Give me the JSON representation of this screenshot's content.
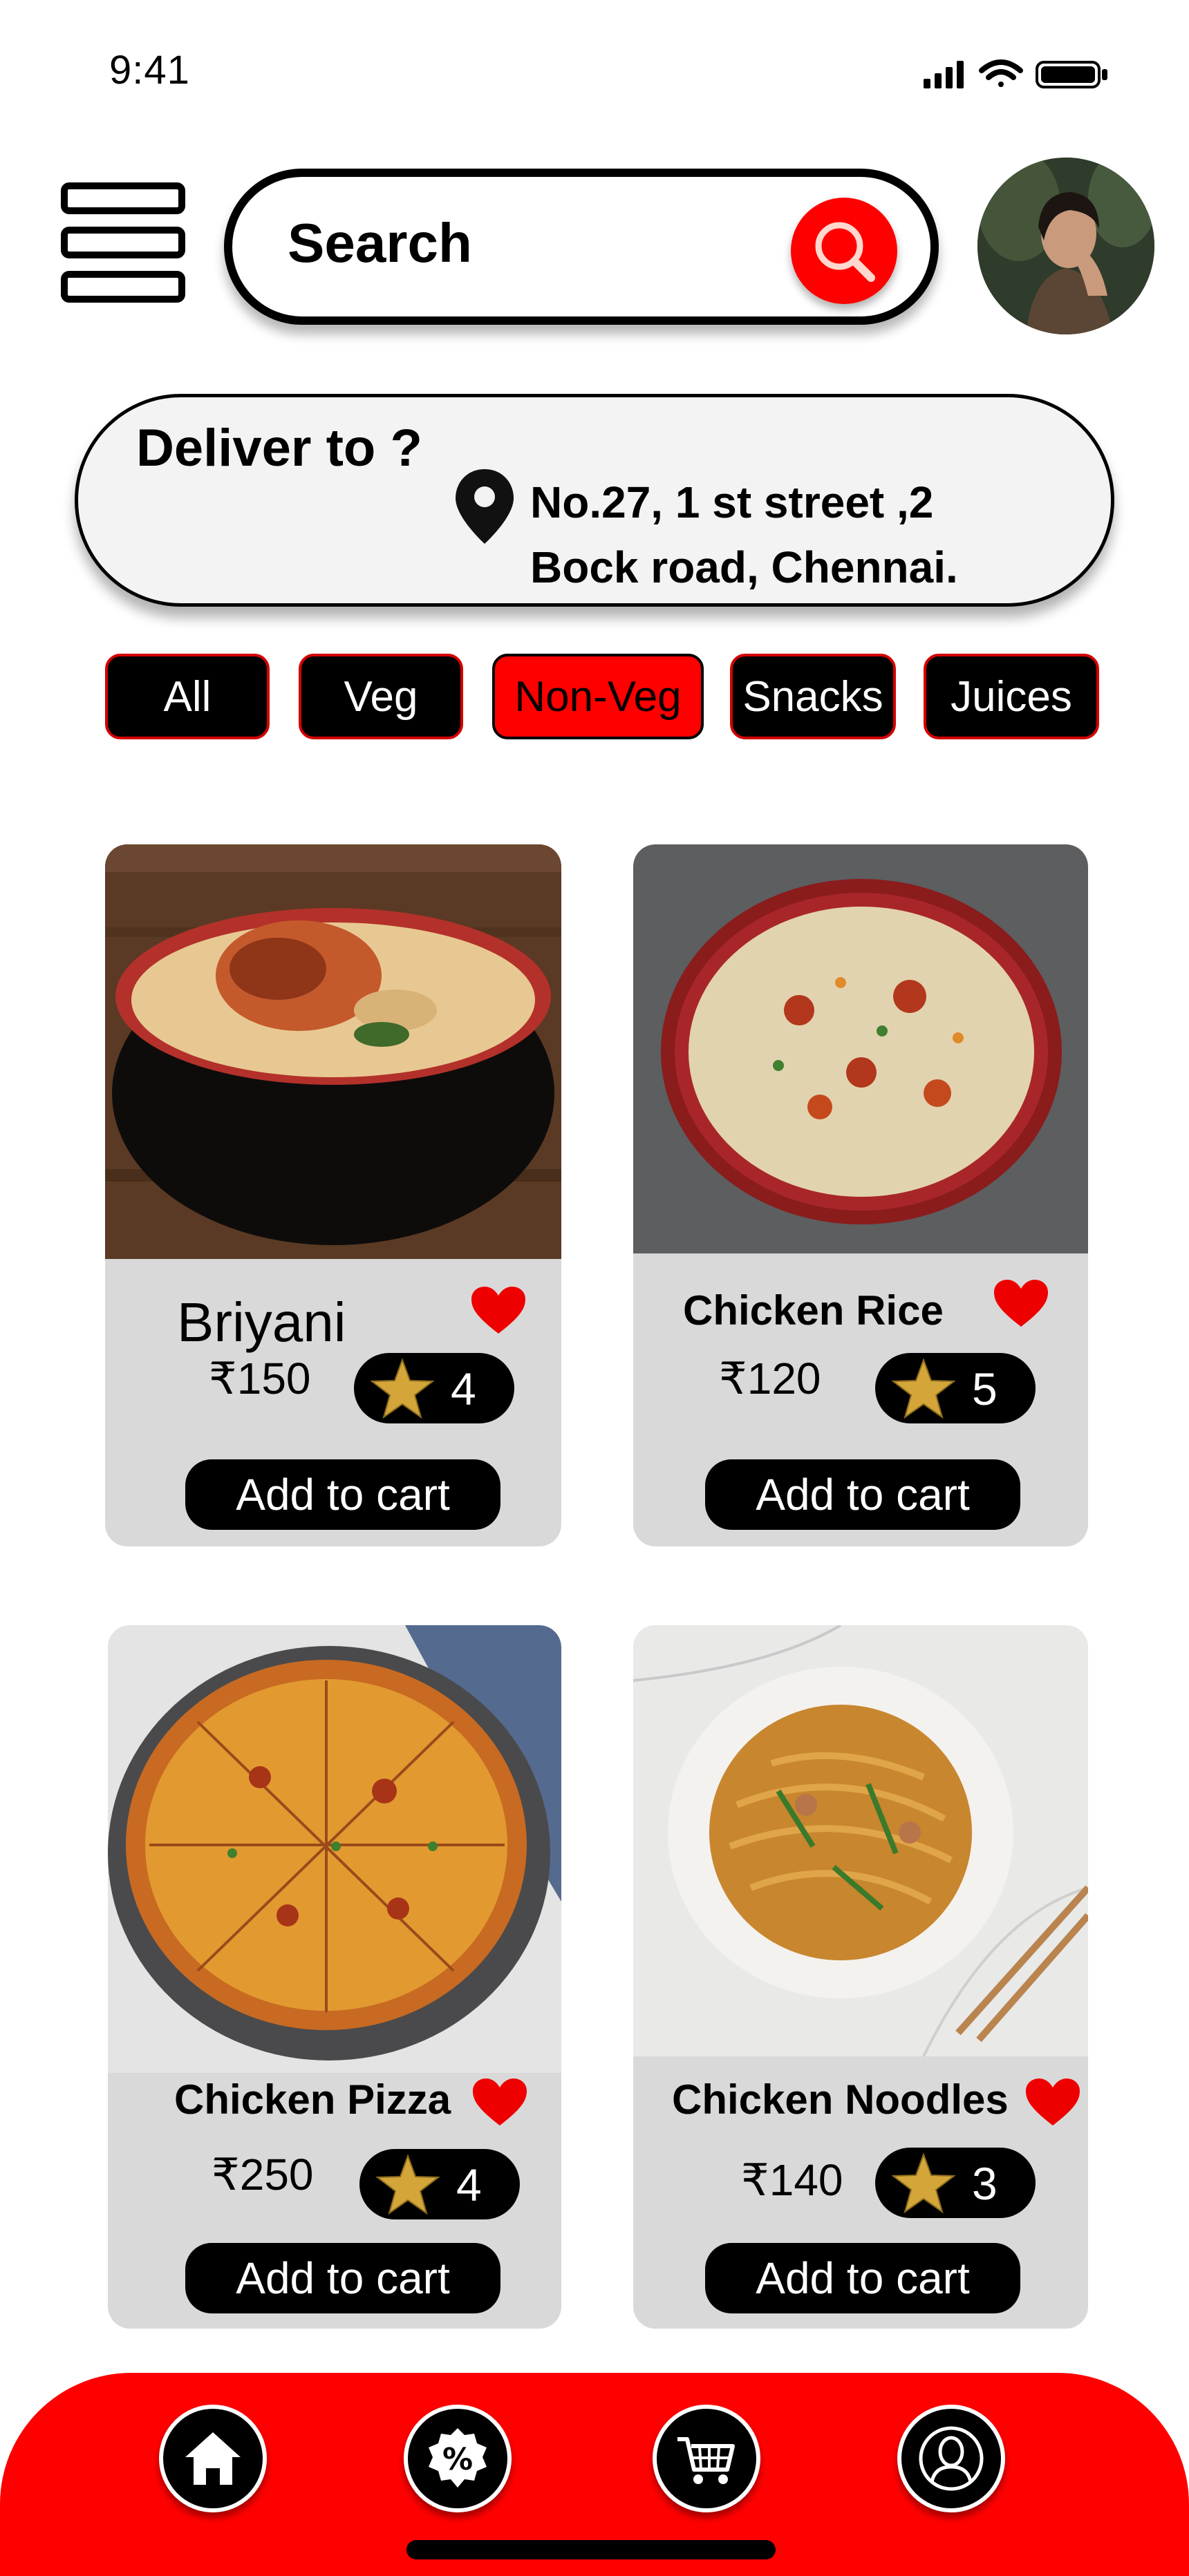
{
  "status_bar": {
    "time": "9:41"
  },
  "search": {
    "placeholder": "Search"
  },
  "delivery": {
    "label": "Deliver to ?",
    "address_line1": "No.27, 1 st street ,2",
    "address_line2": "Bock road, Chennai."
  },
  "tabs": [
    {
      "label": "All",
      "active": false
    },
    {
      "label": "Veg",
      "active": false
    },
    {
      "label": "Non-Veg",
      "active": true
    },
    {
      "label": "Snacks",
      "active": false
    },
    {
      "label": "Juices",
      "active": false
    }
  ],
  "products": [
    {
      "name": "Briyani",
      "price": "₹150",
      "rating": "4",
      "cart_label": "Add to cart",
      "favorited": true
    },
    {
      "name": "Chicken Rice",
      "price": "₹120",
      "rating": "5",
      "cart_label": "Add to cart",
      "favorited": true
    },
    {
      "name": "Chicken Pizza",
      "price": "₹250",
      "rating": "4",
      "cart_label": "Add to cart",
      "favorited": true
    },
    {
      "name": "Chicken Noodles",
      "price": "₹140",
      "rating": "3",
      "cart_label": "Add to cart",
      "favorited": true
    }
  ],
  "bottom_nav": [
    {
      "icon": "home-icon"
    },
    {
      "icon": "offers-icon"
    },
    {
      "icon": "cart-icon"
    },
    {
      "icon": "profile-icon"
    }
  ],
  "colors": {
    "accent": "#ff0000",
    "card_bg": "#d9d9d9",
    "button_bg": "#000000"
  }
}
